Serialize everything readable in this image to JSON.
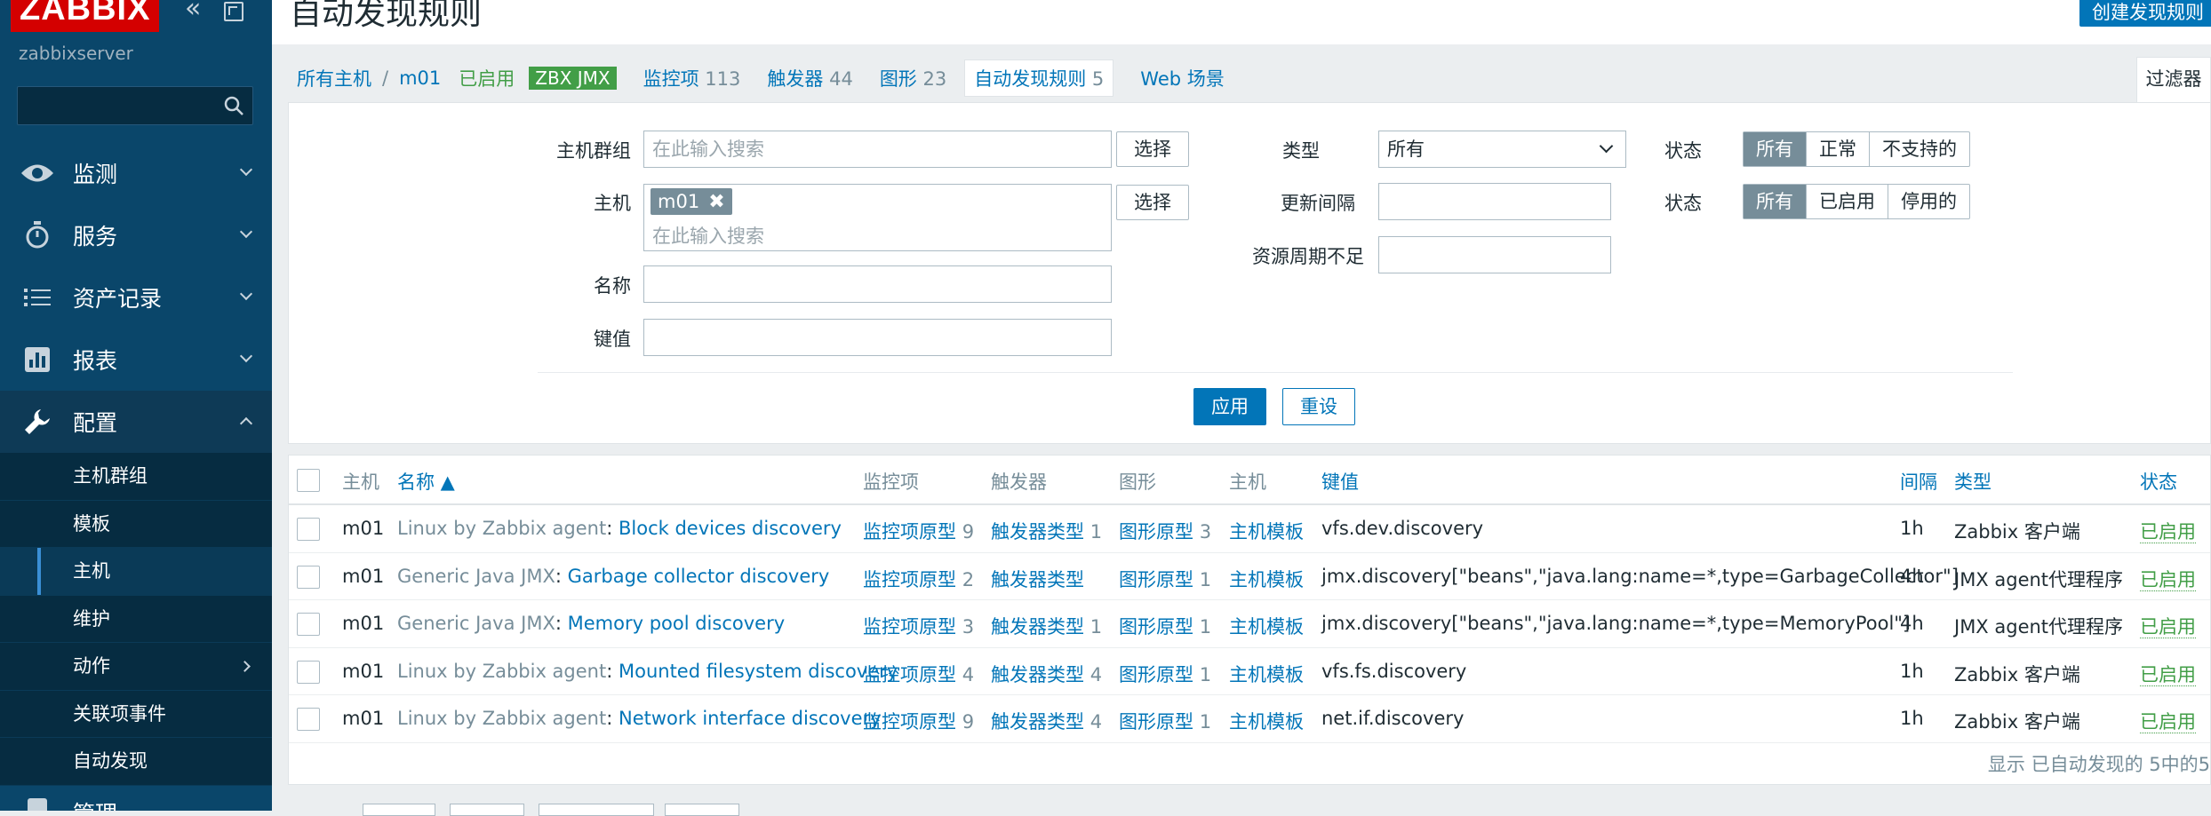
{
  "sidebar": {
    "logo": "ZABBIX",
    "server_name": "zabbixserver",
    "search_placeholder": "",
    "menu": [
      {
        "label": "监测",
        "icon": "eye-icon"
      },
      {
        "label": "服务",
        "icon": "stopwatch-icon"
      },
      {
        "label": "资产记录",
        "icon": "list-icon"
      },
      {
        "label": "报表",
        "icon": "bar-chart-icon"
      },
      {
        "label": "配置",
        "icon": "wrench-icon"
      },
      {
        "label": "管理",
        "icon": "gear-icon"
      }
    ],
    "submenu": [
      "主机群组",
      "模板",
      "主机",
      "维护",
      "动作",
      "关联项事件",
      "自动发现"
    ]
  },
  "header": {
    "title": "自动发现规则",
    "create_button": "创建发现规则"
  },
  "breadcrumb": {
    "all_hosts": "所有主机",
    "host": "m01",
    "status": "已启用",
    "tag": "ZBX JMX",
    "tabs": [
      {
        "label": "监控项",
        "count": "113"
      },
      {
        "label": "触发器",
        "count": "44"
      },
      {
        "label": "图形",
        "count": "23"
      },
      {
        "label": "自动发现规则",
        "count": "5"
      },
      {
        "label": "Web 场景",
        "count": ""
      }
    ]
  },
  "filter": {
    "tab_label": "过滤器",
    "host_group_label": "主机群组",
    "host_group_placeholder": "在此输入搜索",
    "select_label": "选择",
    "host_label": "主机",
    "host_chip": "m01",
    "host_placeholder": "在此输入搜索",
    "name_label": "名称",
    "key_label": "键值",
    "type_label": "类型",
    "type_value": "所有",
    "interval_label": "更新间隔",
    "lifetime_label": "资源周期不足",
    "state_label": "状态",
    "state_options": [
      "所有",
      "正常",
      "不支持的"
    ],
    "status_label": "状态",
    "status_options": [
      "所有",
      "已启用",
      "停用的"
    ],
    "apply": "应用",
    "reset": "重设"
  },
  "table": {
    "headers": {
      "host": "主机",
      "name": "名称 ▲",
      "items": "监控项",
      "triggers": "触发器",
      "graphs": "图形",
      "hosts": "主机",
      "key": "键值",
      "interval": "间隔",
      "type": "类型",
      "status": "状态"
    },
    "rows": [
      {
        "host": "m01",
        "template": "Linux by Zabbix agent",
        "name": "Block devices discovery",
        "items": "监控项原型",
        "items_count": "9",
        "triggers": "触发器类型",
        "triggers_count": "1",
        "graphs": "图形原型",
        "graphs_count": "3",
        "host_proto": "主机模板",
        "key": "vfs.dev.discovery",
        "interval": "1h",
        "type": "Zabbix 客户端",
        "status": "已启用"
      },
      {
        "host": "m01",
        "template": "Generic Java JMX",
        "name": "Garbage collector discovery",
        "items": "监控项原型",
        "items_count": "2",
        "triggers": "触发器类型",
        "triggers_count": "",
        "graphs": "图形原型",
        "graphs_count": "1",
        "host_proto": "主机模板",
        "key": "jmx.discovery[\"beans\",\"java.lang:name=*,type=GarbageCollector\"]",
        "interval": "4h",
        "type": "JMX agent代理程序",
        "status": "已启用"
      },
      {
        "host": "m01",
        "template": "Generic Java JMX",
        "name": "Memory pool discovery",
        "items": "监控项原型",
        "items_count": "3",
        "triggers": "触发器类型",
        "triggers_count": "1",
        "graphs": "图形原型",
        "graphs_count": "1",
        "host_proto": "主机模板",
        "key": "jmx.discovery[\"beans\",\"java.lang:name=*,type=MemoryPool\"]",
        "interval": "4h",
        "type": "JMX agent代理程序",
        "status": "已启用"
      },
      {
        "host": "m01",
        "template": "Linux by Zabbix agent",
        "name": "Mounted filesystem discovery",
        "items": "监控项原型",
        "items_count": "4",
        "triggers": "触发器类型",
        "triggers_count": "4",
        "graphs": "图形原型",
        "graphs_count": "1",
        "host_proto": "主机模板",
        "key": "vfs.fs.discovery",
        "interval": "1h",
        "type": "Zabbix 客户端",
        "status": "已启用"
      },
      {
        "host": "m01",
        "template": "Linux by Zabbix agent",
        "name": "Network interface discovery",
        "items": "监控项原型",
        "items_count": "9",
        "triggers": "触发器类型",
        "triggers_count": "4",
        "graphs": "图形原型",
        "graphs_count": "1",
        "host_proto": "主机模板",
        "key": "net.if.discovery",
        "interval": "1h",
        "type": "Zabbix 客户端",
        "status": "已启用"
      }
    ],
    "footer": "显示 已自动发现的 5中的5"
  },
  "colors": {
    "sidebar_bg": "#0a466a",
    "link": "#0275b8",
    "enabled": "#429e47",
    "brand": "#d40000"
  }
}
